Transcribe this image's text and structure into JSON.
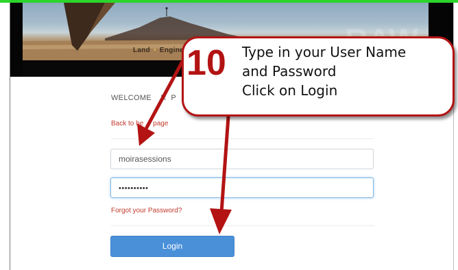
{
  "banner": {
    "nav_items": [
      "Land",
      "Engine"
    ],
    "nav_separator": "•"
  },
  "login": {
    "welcome_text": "WELCOME    R  P",
    "back_link": "Back to he     page",
    "username_value": "moirasessions",
    "password_value": "••••••••••",
    "forgot_link": "Forgot your Password?",
    "login_button": "Login"
  },
  "callout": {
    "number": "10",
    "lines": [
      "Type in your User Name",
      "and Password",
      "Click on Login"
    ],
    "color": "#b31313"
  },
  "colors": {
    "top_bar": "#2bd52b",
    "link_red": "#c0392b",
    "button_blue": "#4a90d9",
    "focus_blue": "#7cb4e4"
  }
}
